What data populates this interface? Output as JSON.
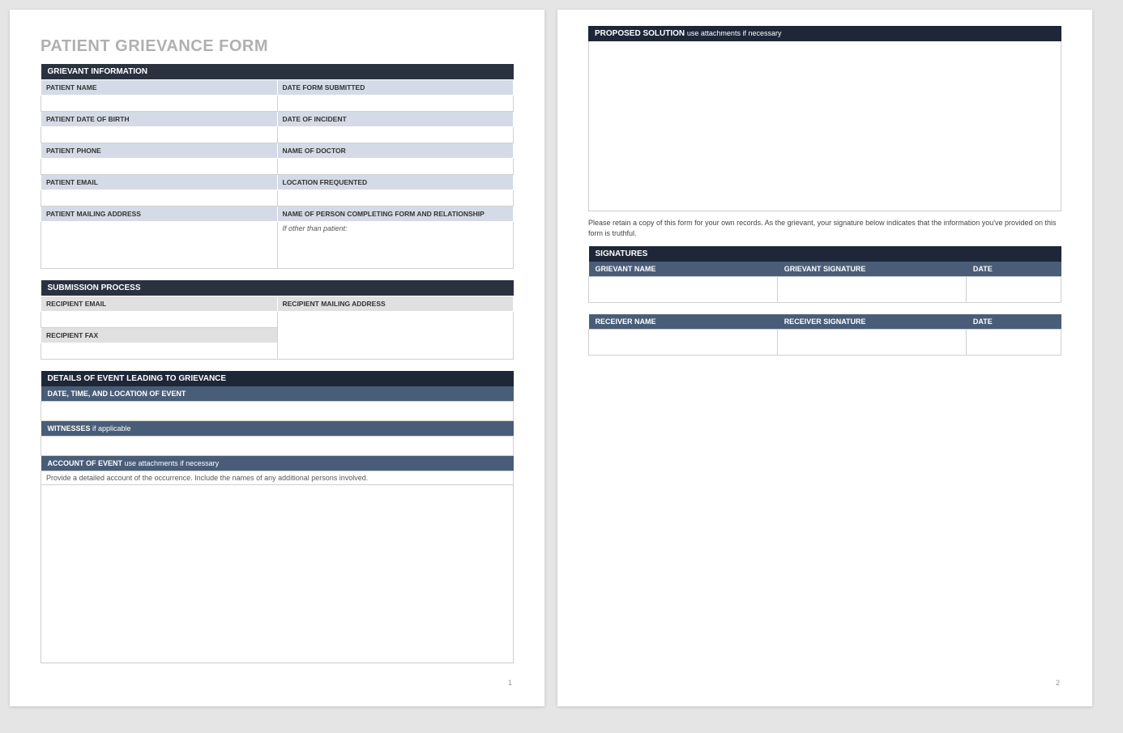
{
  "title": "PATIENT GRIEVANCE FORM",
  "pageNumbers": {
    "p1": "1",
    "p2": "2"
  },
  "sections": {
    "grievant": {
      "header": "GRIEVANT INFORMATION",
      "fields": {
        "patientName": "PATIENT NAME",
        "dateSubmitted": "DATE FORM SUBMITTED",
        "dob": "PATIENT DATE OF BIRTH",
        "dateIncident": "DATE OF INCIDENT",
        "phone": "PATIENT PHONE",
        "doctor": "NAME OF DOCTOR",
        "email": "PATIENT EMAIL",
        "location": "LOCATION FREQUENTED",
        "mailing": "PATIENT MAILING ADDRESS",
        "completer": "NAME OF PERSON COMPLETING FORM AND RELATIONSHIP",
        "completerNote": "If other than patient:"
      }
    },
    "submission": {
      "header": "SUBMISSION PROCESS",
      "fields": {
        "recipientEmail": "RECIPIENT EMAIL",
        "recipientMailing": "RECIPIENT MAILING ADDRESS",
        "recipientFax": "RECIPIENT FAX"
      }
    },
    "details": {
      "header": "DETAILS OF EVENT LEADING TO GRIEVANCE",
      "dateTimeLoc": "DATE, TIME, AND LOCATION OF EVENT",
      "witnesses": "WITNESSES",
      "witnessesSub": "if applicable",
      "account": "ACCOUNT OF EVENT",
      "accountSub": "use attachments if necessary",
      "accountHint": "Provide a detailed account of the occurrence.  Include the names of any additional persons involved."
    },
    "proposed": {
      "header": "PROPOSED SOLUTION",
      "sub": "use attachments if necessary"
    },
    "disclaimer": "Please retain a copy of this form for your own records.  As the grievant, your signature below indicates that the information you've provided on this form is truthful.",
    "signatures": {
      "header": "SIGNATURES",
      "grievantName": "GRIEVANT NAME",
      "grievantSig": "GRIEVANT SIGNATURE",
      "date": "DATE",
      "receiverName": "RECEIVER NAME",
      "receiverSig": "RECEIVER SIGNATURE"
    }
  }
}
